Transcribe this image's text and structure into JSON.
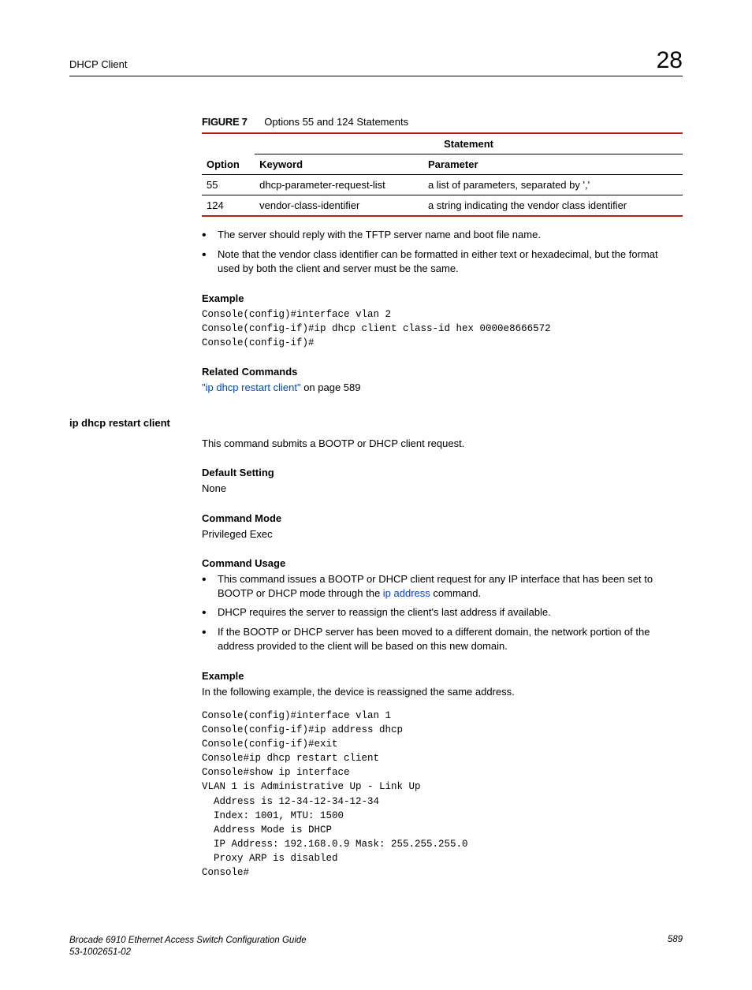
{
  "header": {
    "title": "DHCP Client",
    "chapter": "28"
  },
  "figure": {
    "label": "FIGURE 7",
    "caption": "Options 55 and 124 Statements",
    "headers": {
      "option": "Option",
      "statement": "Statement",
      "keyword": "Keyword",
      "parameter": "Parameter"
    },
    "rows": [
      {
        "option": "55",
        "keyword": "dhcp-parameter-request-list",
        "parameter": "a list of parameters, separated by ','"
      },
      {
        "option": "124",
        "keyword": "vendor-class-identifier",
        "parameter": "a string indicating the vendor class identifier"
      }
    ]
  },
  "notes": [
    "The server should reply with the TFTP server name and boot file name.",
    "Note that the vendor class identifier can be formatted in either text or hexadecimal, but the format used by both the client and server must be the same."
  ],
  "example1": {
    "heading": "Example",
    "code": "Console(config)#interface vlan 2\nConsole(config-if)#ip dhcp client class-id hex 0000e8666572\nConsole(config-if)#"
  },
  "related": {
    "heading": "Related Commands",
    "link_text": "\"ip dhcp restart client\"",
    "suffix": " on page 589"
  },
  "section2": {
    "name": "ip dhcp restart client",
    "intro": "This command submits a BOOTP or DHCP client request.",
    "default_heading": "Default Setting",
    "default_value": "None",
    "mode_heading": "Command Mode",
    "mode_value": "Privileged Exec",
    "usage_heading": "Command Usage",
    "usage_item1_prefix": "This command issues a BOOTP or DHCP client request for any IP interface that has been set to BOOTP or DHCP mode through the ",
    "usage_item1_link": "ip address",
    "usage_item1_suffix": " command.",
    "usage_item2": "DHCP requires the server to reassign the client's last address if available.",
    "usage_item3": "If the BOOTP or DHCP server has been moved to a different domain, the network portion of the address provided to the client will be based on this new domain.",
    "example_heading": "Example",
    "example_intro": "In the following example, the device is reassigned the same address.",
    "example_code": "Console(config)#interface vlan 1\nConsole(config-if)#ip address dhcp\nConsole(config-if)#exit\nConsole#ip dhcp restart client\nConsole#show ip interface\nVLAN 1 is Administrative Up - Link Up\n  Address is 12-34-12-34-12-34\n  Index: 1001, MTU: 1500\n  Address Mode is DHCP\n  IP Address: 192.168.0.9 Mask: 255.255.255.0\n  Proxy ARP is disabled\nConsole#"
  },
  "footer": {
    "line1": "Brocade 6910 Ethernet Access Switch Configuration Guide",
    "line2": "53-1002651-02",
    "page": "589"
  }
}
